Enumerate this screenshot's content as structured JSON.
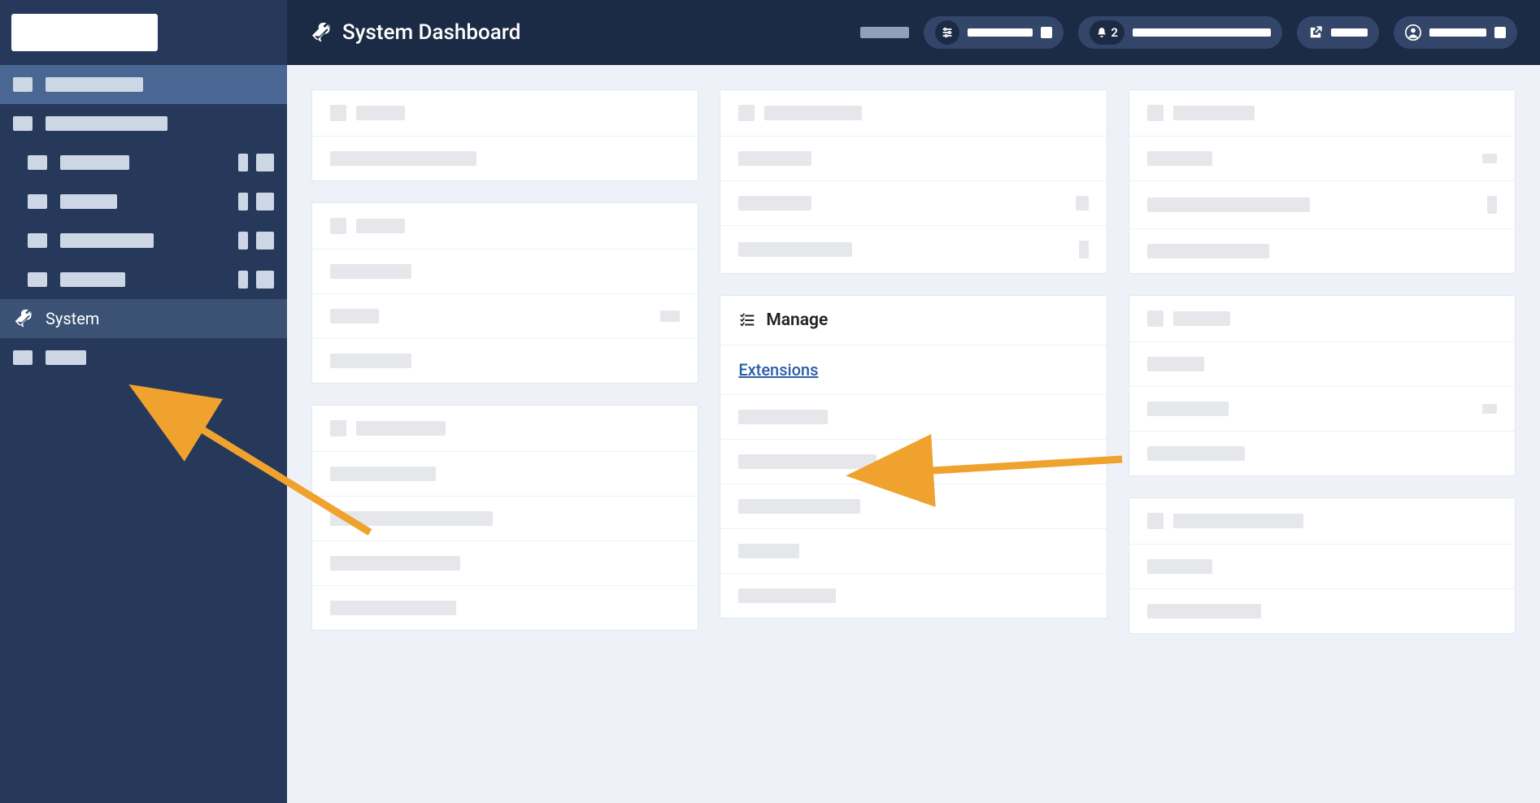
{
  "sidebar": {
    "system_label": "System"
  },
  "topbar": {
    "title": "System Dashboard",
    "notifications_count": "2"
  },
  "cards": {
    "manage": {
      "title": "Manage",
      "extensions_link": "Extensions"
    }
  },
  "colors": {
    "sidebar_bg": "#26395b",
    "topbar_bg": "#1c2b45",
    "pill_bg": "#33466a",
    "arrow": "#f0a22e",
    "link": "#2b5ea8"
  }
}
